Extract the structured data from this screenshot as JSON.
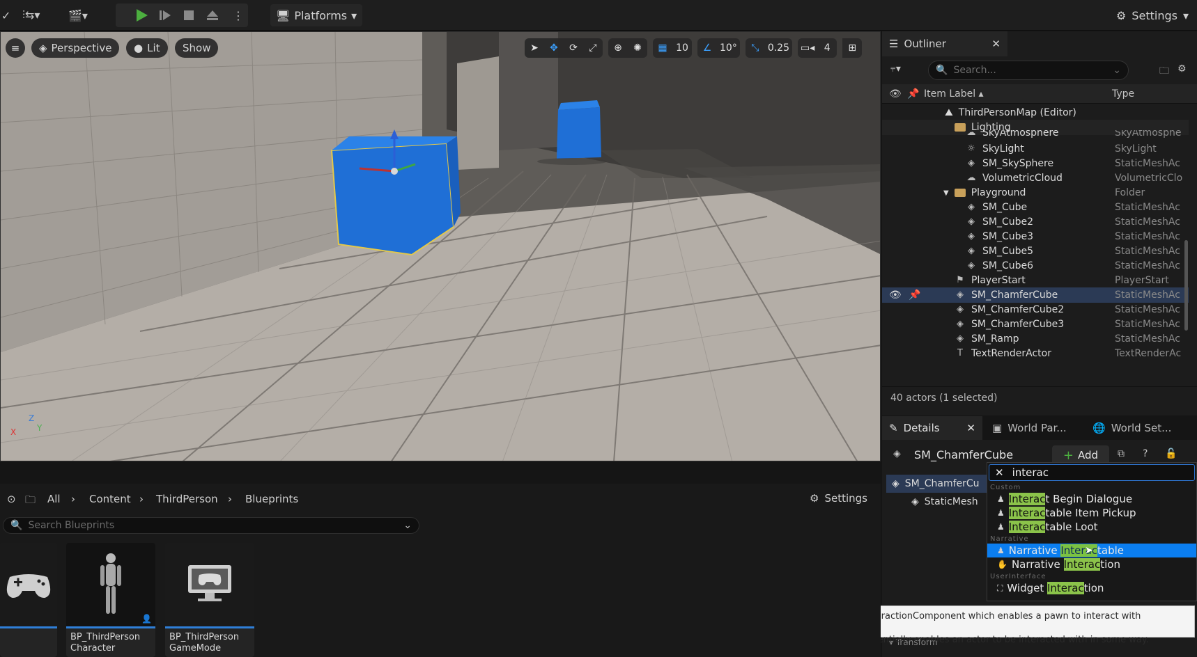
{
  "toolbar": {
    "platforms_label": "Platforms",
    "settings_label": "Settings"
  },
  "viewport": {
    "perspective_label": "Perspective",
    "lit_label": "Lit",
    "show_label": "Show",
    "grid_snap": "10",
    "rotation_snap": "10°",
    "scale_snap": "0.25",
    "camera_speed": "4",
    "axis_labels": {
      "z": "Z",
      "y": "Y",
      "x": "X"
    }
  },
  "outliner": {
    "title": "Outliner",
    "search_placeholder": "Search...",
    "col_label": "Item Label ▴",
    "col_type": "Type",
    "status": "40 actors (1 selected)",
    "rows": [
      {
        "label": "ThirdPersonMap (Editor)",
        "type": ""
      },
      {
        "label": "Lighting",
        "type": ""
      },
      {
        "label": "SkyAtmosphere",
        "type": "SkyAtmosphe"
      },
      {
        "label": "SkyLight",
        "type": "SkyLight"
      },
      {
        "label": "SM_SkySphere",
        "type": "StaticMeshAc"
      },
      {
        "label": "VolumetricCloud",
        "type": "VolumetricClo"
      },
      {
        "label": "Playground",
        "type": "Folder"
      },
      {
        "label": "SM_Cube",
        "type": "StaticMeshAc"
      },
      {
        "label": "SM_Cube2",
        "type": "StaticMeshAc"
      },
      {
        "label": "SM_Cube3",
        "type": "StaticMeshAc"
      },
      {
        "label": "SM_Cube5",
        "type": "StaticMeshAc"
      },
      {
        "label": "SM_Cube6",
        "type": "StaticMeshAc"
      },
      {
        "label": "PlayerStart",
        "type": "PlayerStart"
      },
      {
        "label": "SM_ChamferCube",
        "type": "StaticMeshAc"
      },
      {
        "label": "SM_ChamferCube2",
        "type": "StaticMeshAc"
      },
      {
        "label": "SM_ChamferCube3",
        "type": "StaticMeshAc"
      },
      {
        "label": "SM_Ramp",
        "type": "StaticMeshAc"
      },
      {
        "label": "TextRenderActor",
        "type": "TextRenderAc"
      }
    ]
  },
  "details": {
    "tab_details": "Details",
    "tab_world_partition": "World Par...",
    "tab_world_settings": "World Set...",
    "actor_name": "SM_ChamferCube",
    "add_label": "Add",
    "component_root": "SM_ChamferCu",
    "component_child": "StaticMesh",
    "footer_partial": "Transform"
  },
  "dropdown": {
    "search_value": "interac",
    "categories": {
      "custom": "Custom",
      "narrative": "Narrative",
      "ui": "UserInterface"
    },
    "items": [
      {
        "hl": "Interac",
        "rest": "t Begin Dialogue"
      },
      {
        "hl": "Interac",
        "rest": "table Item Pickup"
      },
      {
        "hl": "Interac",
        "rest": "table Loot"
      },
      {
        "pre": "Narrative ",
        "hl": "Interac",
        "rest": "table"
      },
      {
        "pre": "Narrative ",
        "hl": "Interac",
        "rest": "tion"
      },
      {
        "pre": "Widget ",
        "hl": "Interac",
        "rest": "tion"
      }
    ]
  },
  "tooltip": {
    "line1": "Not to be confused with the NarrativeInteractionComponent which enables a pawn to interact with interactables,",
    "line2": "the NarrativeInteractableComponent essentially enables an actor to be interacted with in some way."
  },
  "content_browser": {
    "crumbs": [
      "All",
      "Content",
      "ThirdPerson",
      "Blueprints"
    ],
    "settings_label": "Settings",
    "search_placeholder": "Search Blueprints",
    "tiles": [
      {
        "line1": "",
        "line2": ""
      },
      {
        "line1": "BP_ThirdPerson",
        "line2": "Character"
      },
      {
        "line1": "BP_ThirdPerson",
        "line2": "GameMode"
      }
    ]
  },
  "colors": {
    "accent": "#0b7ef0",
    "match_highlight": "#8bc34a",
    "play": "#4caf3f",
    "cube": "#1f6fd6"
  }
}
